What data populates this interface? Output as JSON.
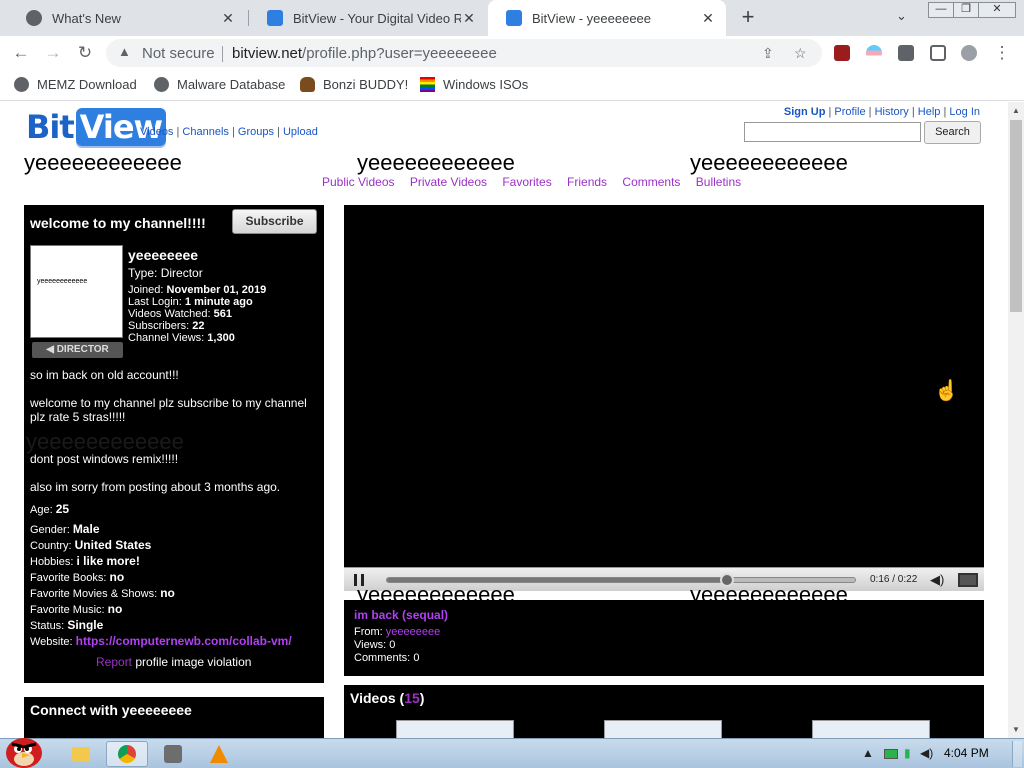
{
  "browser": {
    "tabs": [
      {
        "title": "What's New",
        "close": "✕"
      },
      {
        "title": "BitView - Your Digital Video Re",
        "close": "✕"
      },
      {
        "title": "BitView - yeeeeeeee",
        "close": "✕"
      }
    ],
    "new_tab": "+",
    "tab_search": "⌄",
    "window_controls": {
      "minimize": "—",
      "restore": "❐",
      "close": "✕"
    },
    "nav": {
      "back": "←",
      "forward": "→",
      "reload": "↻"
    },
    "omnibox": {
      "security_label": "Not secure",
      "url_host": "bitview.net",
      "url_path": "/profile.php?user=yeeeeeeee"
    },
    "bookmarks": [
      {
        "label": "MEMZ Download"
      },
      {
        "label": "Malware Database"
      },
      {
        "label": "Bonzi BUDDY!"
      },
      {
        "label": "Windows ISOs"
      }
    ]
  },
  "site": {
    "logo_bit": "Bit",
    "logo_view": "View",
    "top_nav": [
      "Videos",
      "Channels",
      "Groups",
      "Upload"
    ],
    "right_nav": [
      "Sign Up",
      "Profile",
      "History",
      "Help",
      "Log In"
    ],
    "search_button": "Search",
    "search_value": ""
  },
  "profile": {
    "bg_username": "yeeeeeeeeeeee",
    "tabs": [
      "Public Videos",
      "Private Videos",
      "Favorites",
      "Friends",
      "Comments",
      "Bulletins"
    ],
    "channel_title": "welcome to my channel!!!!",
    "subscribe_label": "Subscribe",
    "avatar_text": "yeeeeeeeeeeee",
    "badge": "DIRECTOR",
    "username": "yeeeeeeee",
    "type_label": "Type:",
    "type_value": "Director",
    "joined_label": "Joined:",
    "joined_value": "November 01, 2019",
    "last_login_label": "Last Login:",
    "last_login_value": "1 minute ago",
    "videos_watched_label": "Videos Watched:",
    "videos_watched_value": "561",
    "subscribers_label": "Subscribers:",
    "subscribers_value": "22",
    "channel_views_label": "Channel Views:",
    "channel_views_value": "1,300",
    "description": [
      "so im back on old account!!!",
      "welcome to my channel plz subscribe to my channel",
      "plz rate 5 stras!!!!!",
      "dont post windows remix!!!!!",
      "also im sorry from posting about 3 months ago."
    ],
    "details": {
      "age_label": "Age:",
      "age_value": "25",
      "gender_label": "Gender:",
      "gender_value": "Male",
      "country_label": "Country:",
      "country_value": "United States",
      "hobbies_label": "Hobbies:",
      "hobbies_value": "i like more!",
      "books_label": "Favorite Books:",
      "books_value": "no",
      "movies_label": "Favorite Movies & Shows:",
      "movies_value": "no",
      "music_label": "Favorite Music:",
      "music_value": "no",
      "status_label": "Status:",
      "status_value": "Single",
      "website_label": "Website:",
      "website_value": "https://computernewb.com/collab-vm/"
    },
    "report_link": "Report",
    "report_text": "profile image violation",
    "connect_title": "Connect with yeeeeeeee"
  },
  "player": {
    "time": "0:16 / 0:22",
    "progress": 0.727
  },
  "video": {
    "title": "im back (sequal)",
    "from_label": "From:",
    "from_user": "yeeeeeeee",
    "views_label": "Views:",
    "views_value": "0",
    "comments_label": "Comments:",
    "comments_value": "0"
  },
  "videos_section": {
    "label": "Videos",
    "count": "15"
  },
  "taskbar": {
    "clock": "4:04 PM"
  }
}
